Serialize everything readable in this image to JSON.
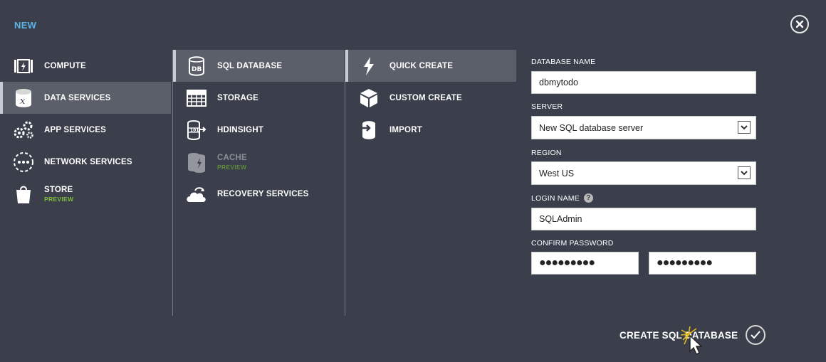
{
  "header": {
    "title": "NEW"
  },
  "col1": [
    {
      "label": "COMPUTE",
      "icon": "compute-icon"
    },
    {
      "label": "DATA SERVICES",
      "icon": "data-services-icon",
      "selected": true
    },
    {
      "label": "APP SERVICES",
      "icon": "app-services-icon"
    },
    {
      "label": "NETWORK SERVICES",
      "icon": "network-services-icon"
    },
    {
      "label": "STORE",
      "sub": "PREVIEW",
      "icon": "store-icon"
    }
  ],
  "col2": [
    {
      "label": "SQL DATABASE",
      "icon": "sql-database-icon",
      "selected": true
    },
    {
      "label": "STORAGE",
      "icon": "storage-icon"
    },
    {
      "label": "HDINSIGHT",
      "icon": "hdinsight-icon"
    },
    {
      "label": "CACHE",
      "sub": "PREVIEW",
      "icon": "cache-icon",
      "disabled": true
    },
    {
      "label": "RECOVERY SERVICES",
      "icon": "recovery-services-icon"
    }
  ],
  "col3": [
    {
      "label": "QUICK CREATE",
      "icon": "lightning-icon",
      "selected": true
    },
    {
      "label": "CUSTOM CREATE",
      "icon": "cube-icon"
    },
    {
      "label": "IMPORT",
      "icon": "import-icon"
    }
  ],
  "form": {
    "database_name_label": "DATABASE NAME",
    "database_name": "dbmytodo",
    "server_label": "SERVER",
    "server_value": "New SQL database server",
    "region_label": "REGION",
    "region_value": "West US",
    "login_label": "LOGIN NAME",
    "login_value": "SQLAdmin",
    "password_label": "CONFIRM PASSWORD",
    "password_mask": "●●●●●●●●●",
    "confirm_mask": "●●●●●●●●●",
    "help_glyph": "?"
  },
  "footer": {
    "create_label": "CREATE SQL DATABASE"
  },
  "colors": {
    "background": "#3a3f4b",
    "selected": "#5b5f69",
    "accent": "#5ab4e6",
    "preview": "#7cbf3f"
  }
}
